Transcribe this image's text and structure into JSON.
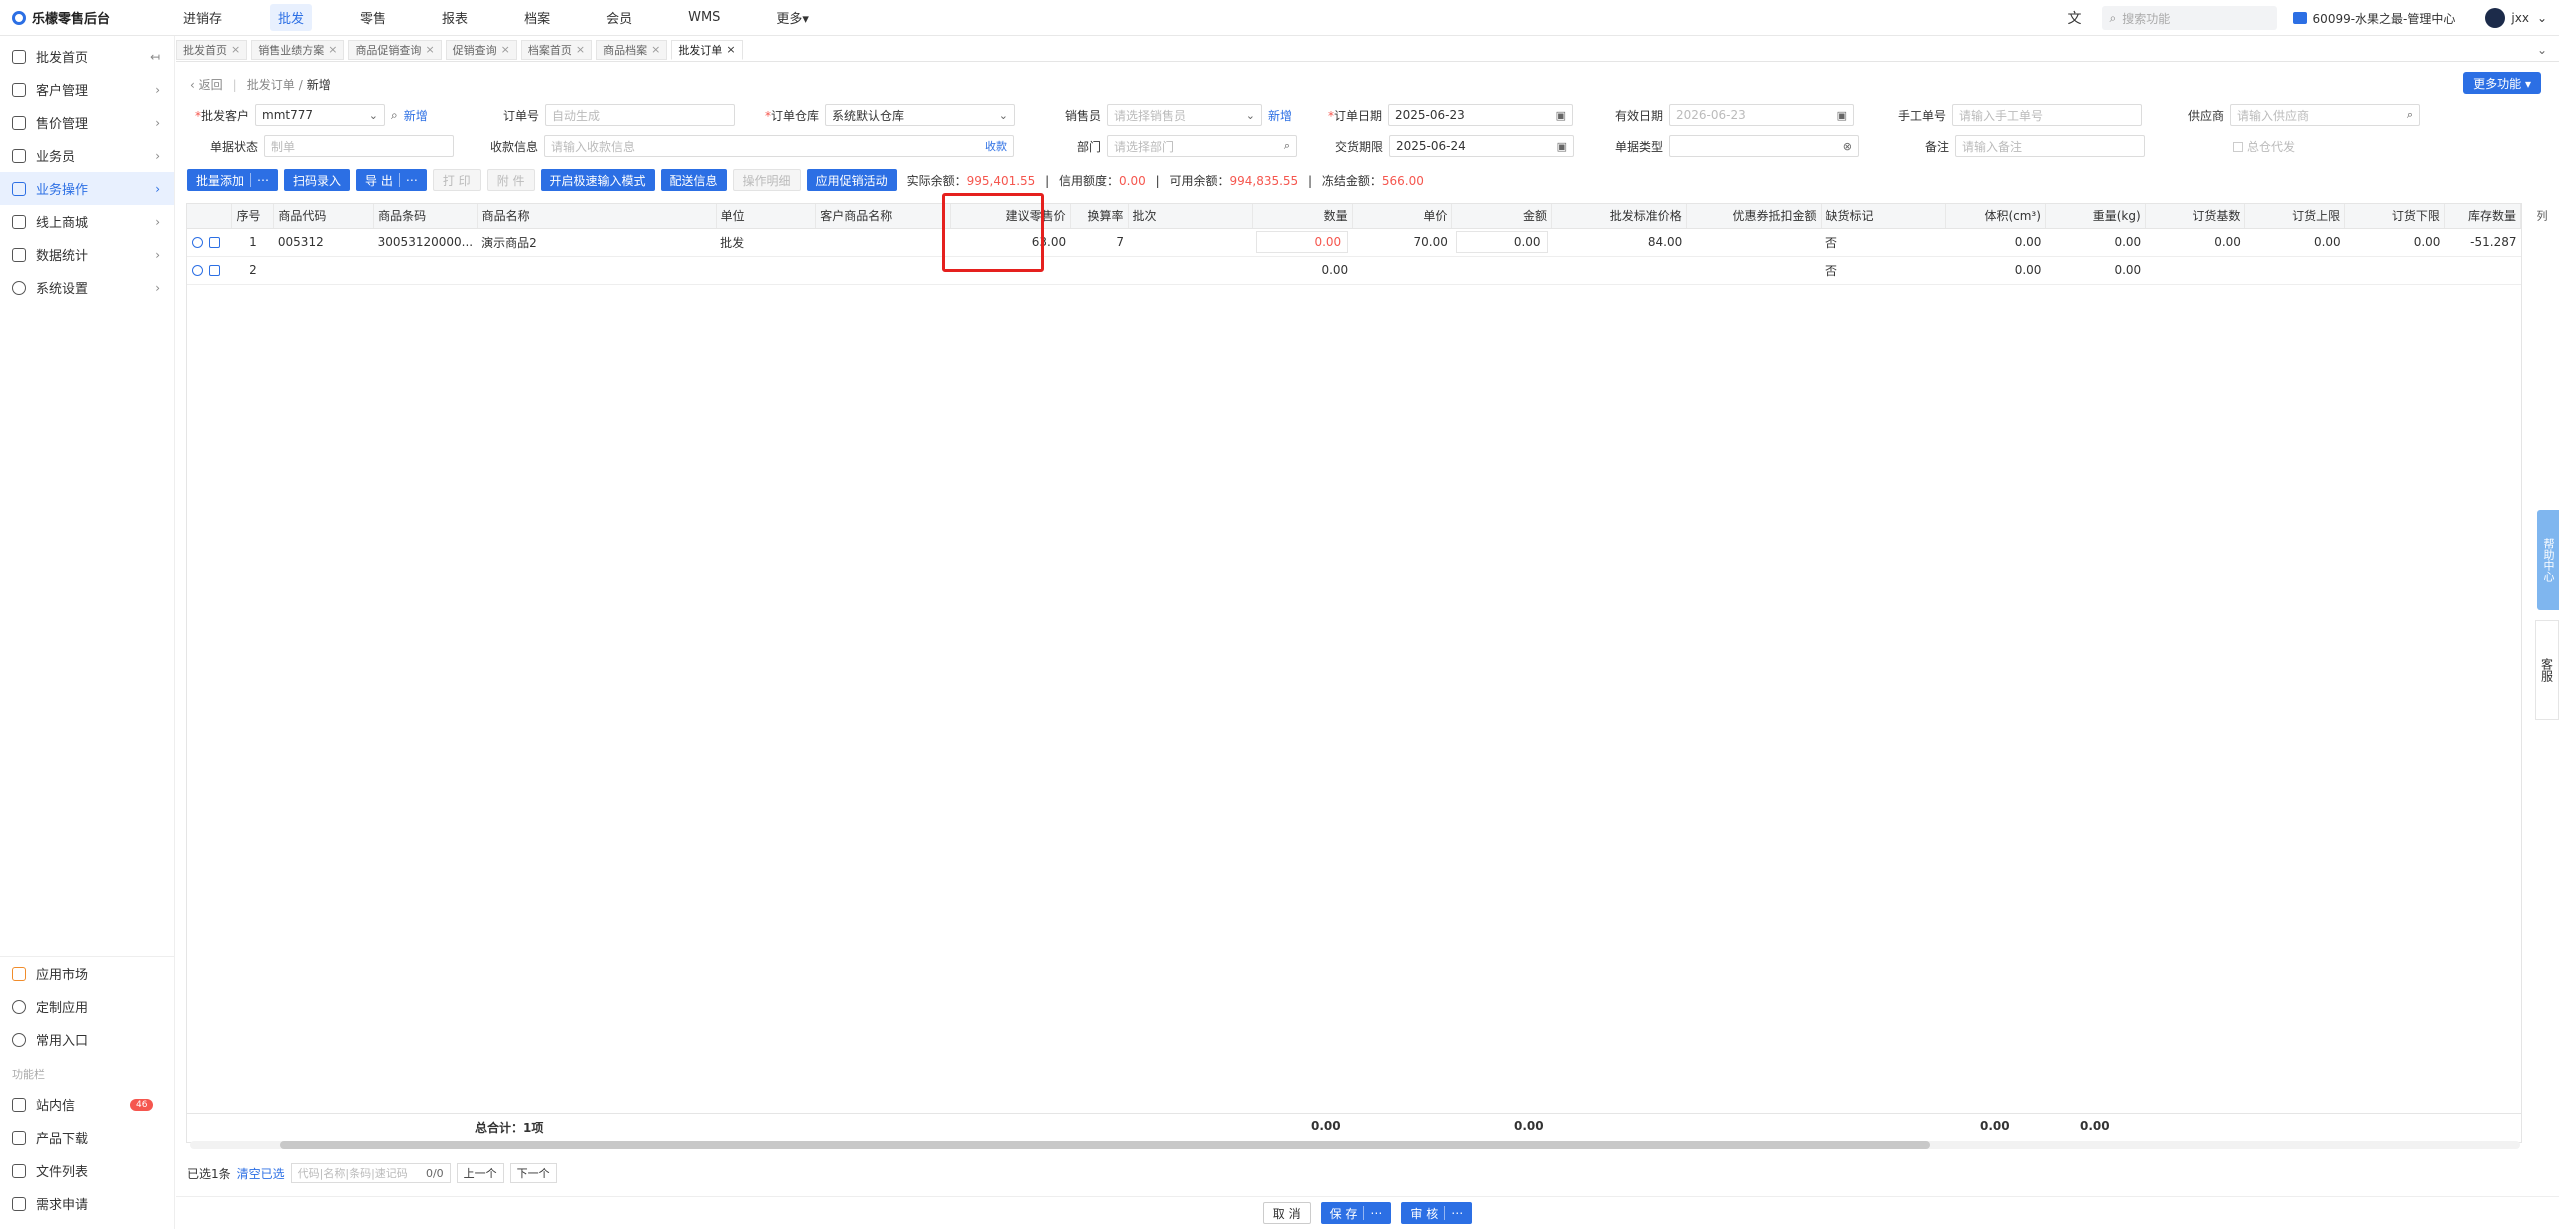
{
  "topbar": {
    "logo": "乐檬零售后台",
    "nav": [
      "进销存",
      "批发",
      "零售",
      "报表",
      "档案",
      "会员",
      "WMS",
      "更多▾"
    ],
    "active_nav": "批发",
    "search_placeholder": "搜索功能",
    "store": "60099-水果之最-管理中心",
    "user": "jxx"
  },
  "sidebar": {
    "items": [
      {
        "label": "批发首页",
        "arrow": "↤"
      },
      {
        "label": "客户管理",
        "arrow": "›"
      },
      {
        "label": "售价管理",
        "arrow": "›"
      },
      {
        "label": "业务员",
        "arrow": "›"
      },
      {
        "label": "业务操作",
        "arrow": "›"
      },
      {
        "label": "线上商城",
        "arrow": "›"
      },
      {
        "label": "数据统计",
        "arrow": "›"
      },
      {
        "label": "系统设置",
        "arrow": "›"
      }
    ],
    "bottom_items": [
      "应用市场",
      "定制应用",
      "常用入口"
    ],
    "section": "功能栏",
    "func_items": [
      "站内信",
      "产品下载",
      "文件列表",
      "需求申请"
    ],
    "msg_badge": "46"
  },
  "tabs": [
    "批发首页",
    "销售业绩方案",
    "商品促销查询",
    "促销查询",
    "档案首页",
    "商品档案",
    "批发订单"
  ],
  "breadcrumb": {
    "back": "返回",
    "parent": "批发订单",
    "current": "新增"
  },
  "more_func": "更多功能 ▾",
  "form": {
    "customer_label": "批发客户",
    "customer_value": "mmt777",
    "new": "新增",
    "order_no_label": "订单号",
    "order_no_ph": "自动生成",
    "warehouse_label": "订单仓库",
    "warehouse_value": "系统默认仓库",
    "sales_label": "销售员",
    "sales_ph": "请选择销售员",
    "date_label": "订单日期",
    "date_value": "2025-06-23",
    "valid_label": "有效日期",
    "valid_value": "2026-06-23",
    "manual_label": "手工单号",
    "manual_ph": "请输入手工单号",
    "supplier_label": "供应商",
    "supplier_ph": "请输入供应商",
    "status_label": "单据状态",
    "status_value": "制单",
    "payment_label": "收款信息",
    "payment_ph": "请输入收款信息",
    "collect": "收款",
    "dept_label": "部门",
    "dept_ph": "请选择部门",
    "delivery_label": "交货期限",
    "delivery_value": "2025-06-24",
    "type_label": "单据类型",
    "remark_label": "备注",
    "remark_ph": "请输入备注",
    "agent_label": "总仓代发"
  },
  "toolbar": {
    "batch_add": "批量添加",
    "scan": "扫码录入",
    "export": "导 出",
    "print": "打 印",
    "attach": "附 件",
    "fast_mode": "开启极速输入模式",
    "delivery": "配送信息",
    "op_detail": "操作明细",
    "promo": "应用促销活动",
    "stats": {
      "actual_label": "实际余额：",
      "actual": "995,401.55",
      "credit_label": "信用额度：",
      "credit": "0.00",
      "avail_label": "可用余额：",
      "avail": "994,835.55",
      "frozen_label": "冻结金额：",
      "frozen": "566.00"
    }
  },
  "table": {
    "headers": [
      "序号",
      "商品代码",
      "商品条码",
      "商品名称",
      "单位",
      "客户商品名称",
      "建议零售价",
      "换算率",
      "批次",
      "数量",
      "单价",
      "金额",
      "批发标准价格",
      "优惠券抵扣金额",
      "缺货标记",
      "体积(cm³)",
      "重量(kg)",
      "订货基数",
      "订货上限",
      "订货下限",
      "库存数量"
    ],
    "rows": [
      {
        "seq": "1",
        "code": "005312",
        "barcode": "30053120000...",
        "name": "演示商品2",
        "unit": "批发",
        "cust_name": "",
        "retail": "63.00",
        "ratio": "7",
        "batch": "",
        "qty": "0.00",
        "price": "70.00",
        "amount": "0.00",
        "std_price": "84.00",
        "coupon": "",
        "oos": "否",
        "volume": "0.00",
        "weight": "0.00",
        "base": "0.00",
        "upper": "0.00",
        "lower": "0.00",
        "stock": "-51.287"
      },
      {
        "seq": "2",
        "code": "",
        "barcode": "",
        "name": "",
        "unit": "",
        "cust_name": "",
        "retail": "",
        "ratio": "",
        "batch": "",
        "qty": "0.00",
        "price": "",
        "amount": "",
        "std_price": "",
        "coupon": "",
        "oos": "否",
        "volume": "0.00",
        "weight": "0.00",
        "base": "",
        "upper": "",
        "lower": "",
        "stock": ""
      }
    ],
    "total_label": "总合计：1项",
    "total_qty": "0.00",
    "total_amount": "0.00",
    "total_volume": "0.00",
    "total_weight": "0.00"
  },
  "selbar": {
    "selected": "已选1条",
    "clear": "清空已选",
    "search_ph": "代码|名称|条码|速记码",
    "count": "0/0",
    "prev": "上一个",
    "next": "下一个"
  },
  "bottom": {
    "cancel": "取 消",
    "save": "保 存",
    "audit": "审 核"
  },
  "float": {
    "help": "帮助中心",
    "service": "客服",
    "colset": "列"
  }
}
